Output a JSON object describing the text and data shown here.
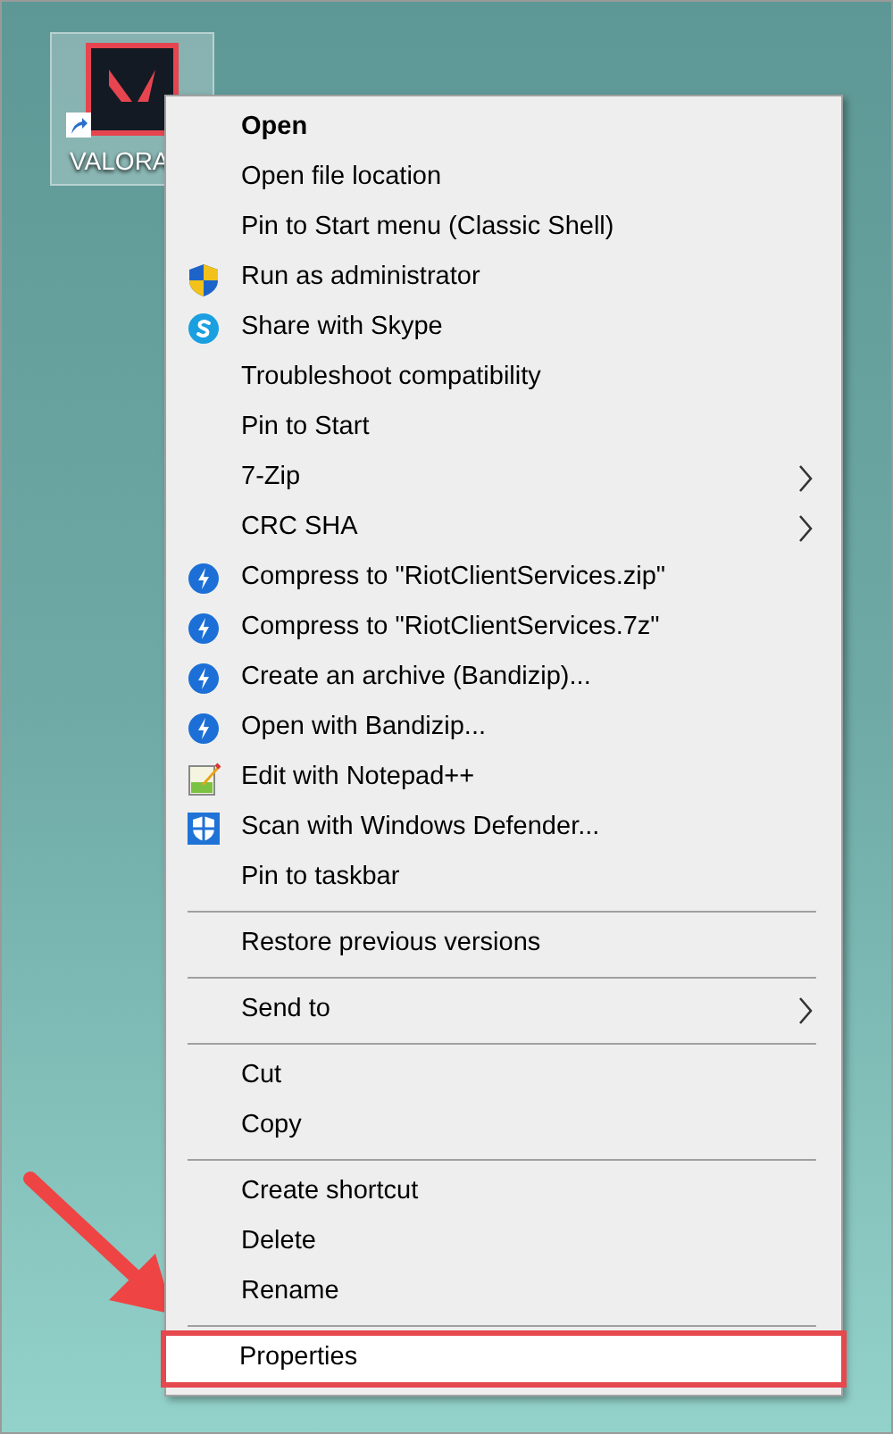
{
  "desktop_icon": {
    "label": "VALORA",
    "selected": true
  },
  "context_menu": {
    "items": [
      {
        "kind": "plain",
        "label": "Open",
        "default": true,
        "submenu": false,
        "selected": false
      },
      {
        "kind": "plain",
        "label": "Open file location",
        "default": false,
        "submenu": false,
        "selected": false
      },
      {
        "kind": "plain",
        "label": "Pin to Start menu (Classic Shell)",
        "default": false,
        "submenu": false,
        "selected": false
      },
      {
        "kind": "shield",
        "label": "Run as administrator",
        "default": false,
        "submenu": false,
        "selected": false
      },
      {
        "kind": "skype",
        "label": "Share with Skype",
        "default": false,
        "submenu": false,
        "selected": false
      },
      {
        "kind": "plain",
        "label": "Troubleshoot compatibility",
        "default": false,
        "submenu": false,
        "selected": false
      },
      {
        "kind": "plain",
        "label": "Pin to Start",
        "default": false,
        "submenu": false,
        "selected": false
      },
      {
        "kind": "plain",
        "label": "7-Zip",
        "default": false,
        "submenu": true,
        "selected": false
      },
      {
        "kind": "plain",
        "label": "CRC SHA",
        "default": false,
        "submenu": true,
        "selected": false
      },
      {
        "kind": "bandizip",
        "label": "Compress to \"RiotClientServices.zip\"",
        "default": false,
        "submenu": false,
        "selected": false
      },
      {
        "kind": "bandizip",
        "label": "Compress to \"RiotClientServices.7z\"",
        "default": false,
        "submenu": false,
        "selected": false
      },
      {
        "kind": "bandizip",
        "label": "Create an archive (Bandizip)...",
        "default": false,
        "submenu": false,
        "selected": false
      },
      {
        "kind": "bandizip",
        "label": "Open with Bandizip...",
        "default": false,
        "submenu": false,
        "selected": false
      },
      {
        "kind": "notepad",
        "label": "Edit with Notepad++",
        "default": false,
        "submenu": false,
        "selected": false
      },
      {
        "kind": "defender",
        "label": "Scan with Windows Defender...",
        "default": false,
        "submenu": false,
        "selected": false
      },
      {
        "kind": "plain",
        "label": "Pin to taskbar",
        "default": false,
        "submenu": false,
        "selected": false
      },
      {
        "kind": "separator"
      },
      {
        "kind": "plain",
        "label": "Restore previous versions",
        "default": false,
        "submenu": false,
        "selected": false
      },
      {
        "kind": "separator"
      },
      {
        "kind": "plain",
        "label": "Send to",
        "default": false,
        "submenu": true,
        "selected": false
      },
      {
        "kind": "separator"
      },
      {
        "kind": "plain",
        "label": "Cut",
        "default": false,
        "submenu": false,
        "selected": false
      },
      {
        "kind": "plain",
        "label": "Copy",
        "default": false,
        "submenu": false,
        "selected": false
      },
      {
        "kind": "separator"
      },
      {
        "kind": "plain",
        "label": "Create shortcut",
        "default": false,
        "submenu": false,
        "selected": false
      },
      {
        "kind": "plain",
        "label": "Delete",
        "default": false,
        "submenu": false,
        "selected": false
      },
      {
        "kind": "plain",
        "label": "Rename",
        "default": false,
        "submenu": false,
        "selected": false
      },
      {
        "kind": "separator"
      },
      {
        "kind": "plain",
        "label": "Properties",
        "default": false,
        "submenu": false,
        "selected": true
      }
    ]
  }
}
